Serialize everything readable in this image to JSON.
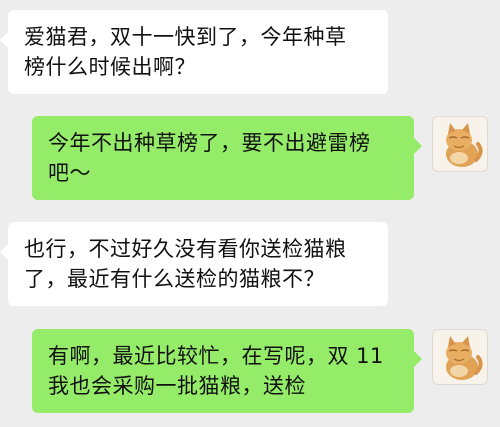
{
  "messages": [
    {
      "sender": "other",
      "text": "爱猫君，双十一快到了，今年种草\n榜什么时候出啊？"
    },
    {
      "sender": "self",
      "text": "今年不出种草榜了，要不出避雷榜\n吧～"
    },
    {
      "sender": "other",
      "text": "也行，不过好久没有看你送检猫粮\n了，最近有什么送检的猫粮不？"
    },
    {
      "sender": "self",
      "text": "有啊，最近比较忙，在写呢，双 11\n我也会采购一批猫粮，送检"
    }
  ],
  "avatar": {
    "icon": "orange-cat-avatar-icon"
  },
  "colors": {
    "background": "#ededed",
    "incoming_bubble": "#ffffff",
    "outgoing_bubble": "#95ec69"
  }
}
